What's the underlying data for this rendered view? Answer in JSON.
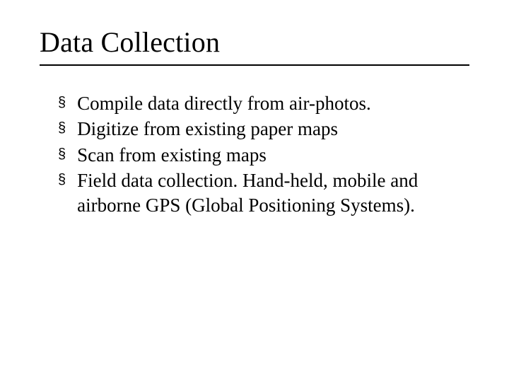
{
  "slide": {
    "title": "Data Collection",
    "bullets": [
      {
        "marker": "§",
        "text": "Compile data directly from air-photos."
      },
      {
        "marker": "§",
        "text": "Digitize from existing paper maps"
      },
      {
        "marker": "§",
        "text": "Scan from existing maps"
      },
      {
        "marker": "§",
        "text": "Field data collection.  Hand-held, mobile and airborne GPS (Global Positioning Systems)."
      }
    ]
  }
}
